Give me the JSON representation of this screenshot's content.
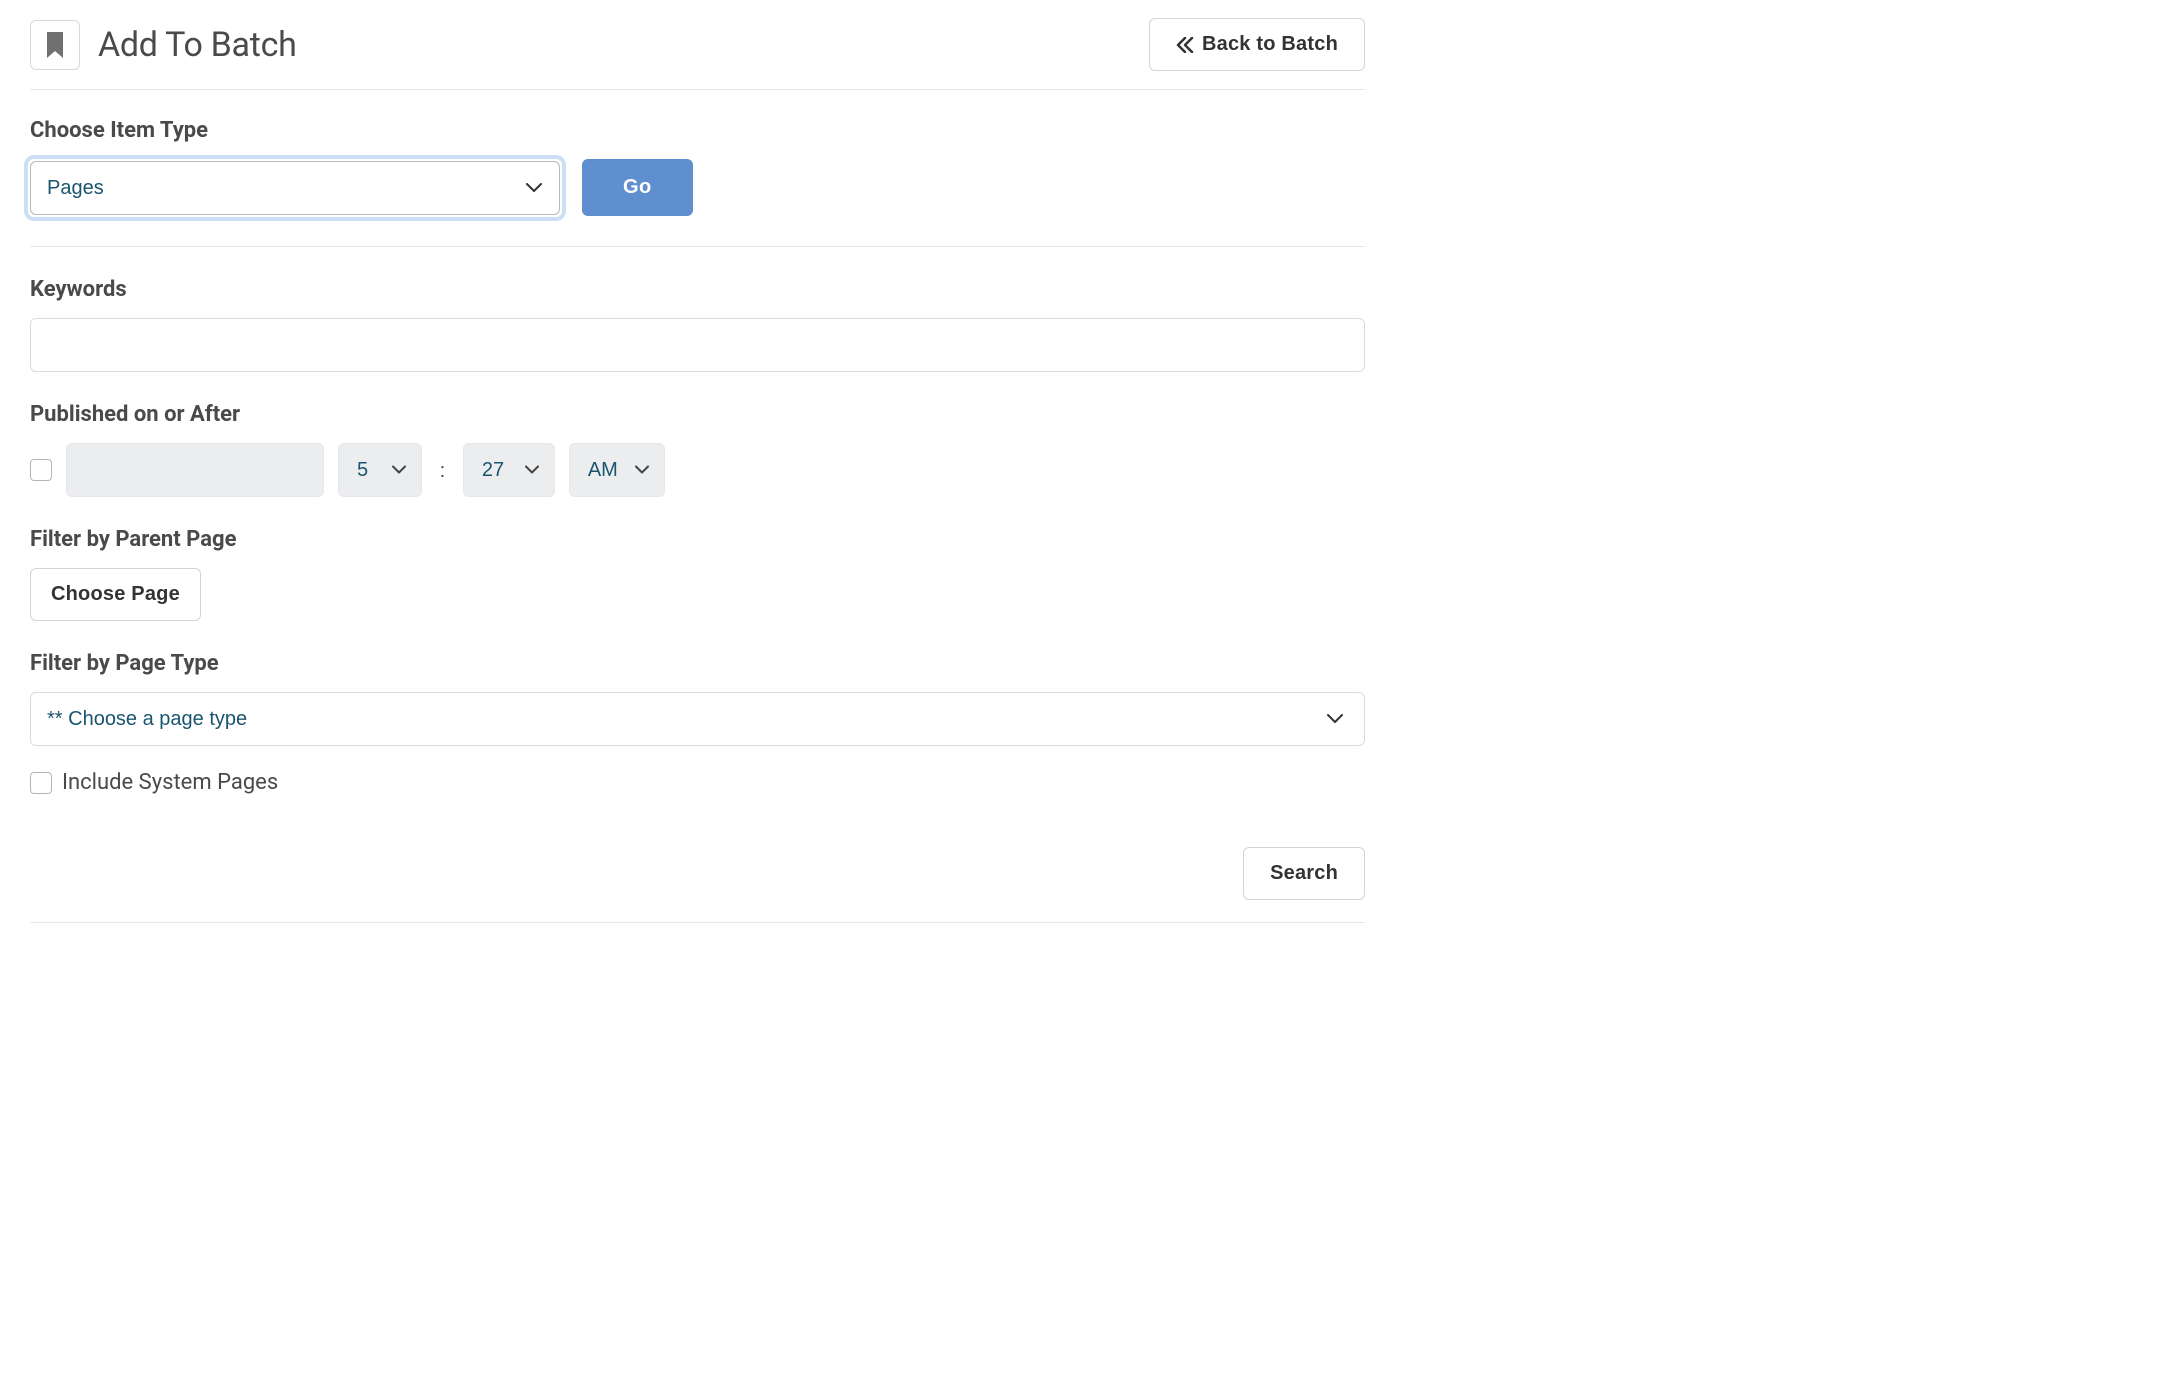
{
  "header": {
    "title": "Add To Batch",
    "back_label": "Back to Batch"
  },
  "item_type": {
    "label": "Choose Item Type",
    "selected": "Pages",
    "go_label": "Go"
  },
  "keywords": {
    "label": "Keywords",
    "value": ""
  },
  "published": {
    "label": "Published on or After",
    "enabled": false,
    "date": "",
    "hour": "5",
    "minute": "27",
    "ampm": "AM"
  },
  "parent_page": {
    "label": "Filter by Parent Page",
    "choose_label": "Choose Page"
  },
  "page_type": {
    "label": "Filter by Page Type",
    "selected": "** Choose a page type"
  },
  "include_system": {
    "label": "Include System Pages",
    "checked": false
  },
  "search_label": "Search"
}
